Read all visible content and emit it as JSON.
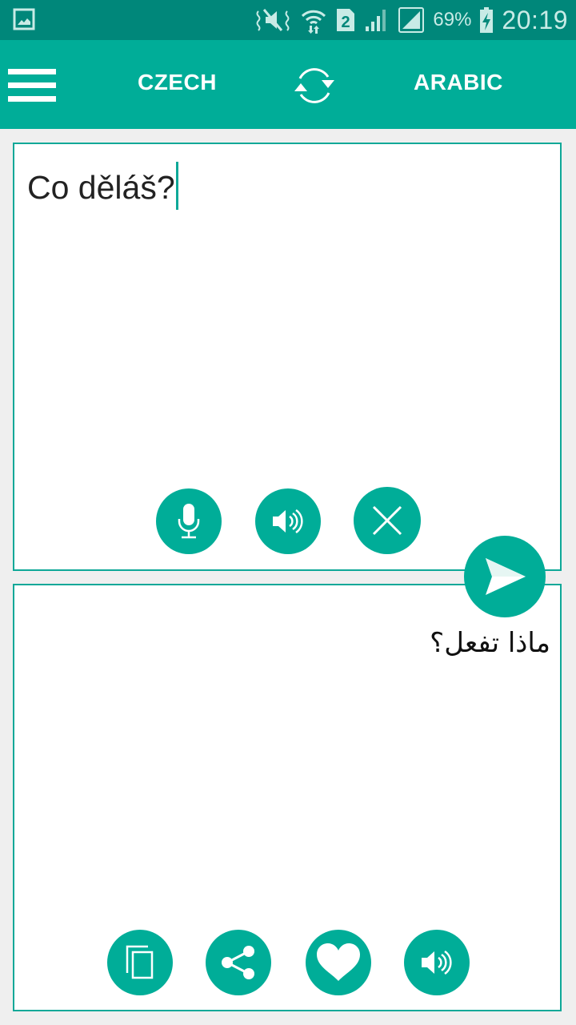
{
  "status_bar": {
    "left_icons": [
      "gallery-icon"
    ],
    "right_icons": [
      "mute-vibrate-icon",
      "wifi-data-icon",
      "sim-2-icon",
      "signal-icon",
      "signal-alt-icon"
    ],
    "battery_percent": "69%",
    "battery_icon": "battery-charging-icon",
    "time": "20:19"
  },
  "app_bar": {
    "menu_icon": "hamburger-menu-icon",
    "source_language": "CZECH",
    "swap_icon": "swap-languages-icon",
    "target_language": "ARABIC"
  },
  "input_panel": {
    "text": "Co děláš?",
    "actions": [
      {
        "name": "microphone",
        "icon": "microphone-icon"
      },
      {
        "name": "speak-input",
        "icon": "speaker-icon"
      },
      {
        "name": "clear",
        "icon": "close-icon"
      }
    ]
  },
  "translate_button": {
    "icon": "send-icon"
  },
  "output_panel": {
    "text": "ماذا تفعل؟",
    "actions": [
      {
        "name": "copy",
        "icon": "copy-icon"
      },
      {
        "name": "share",
        "icon": "share-icon"
      },
      {
        "name": "favorite",
        "icon": "heart-icon"
      },
      {
        "name": "speak-output",
        "icon": "speaker-icon"
      }
    ]
  },
  "colors": {
    "status_bar": "#00877a",
    "primary": "#00ad98",
    "border": "#0ea898",
    "background": "#efefef"
  }
}
